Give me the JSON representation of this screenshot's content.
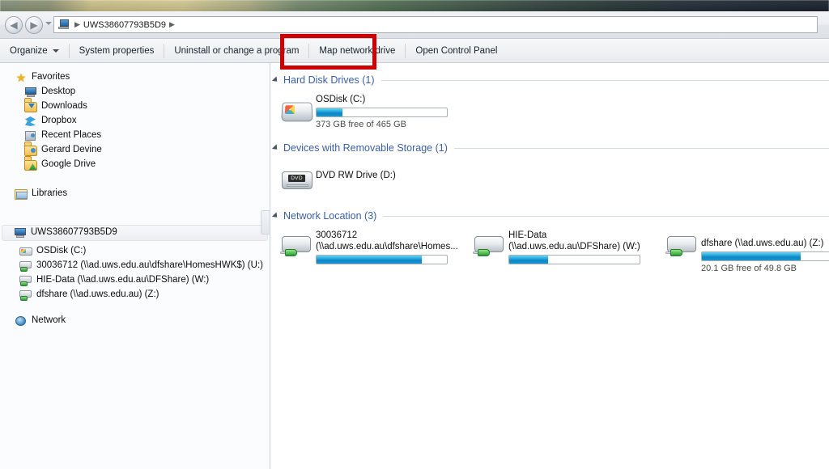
{
  "window": {
    "address_path": "UWS38607793B5D9",
    "address_icon": "computer-icon",
    "back_icon": "back-arrow-icon",
    "forward_icon": "forward-arrow-icon",
    "history_icon": "chevron-down-icon"
  },
  "toolbar": {
    "items": [
      {
        "label": "Organize",
        "has_caret": true
      },
      {
        "label": "System properties",
        "has_caret": false
      },
      {
        "label": "Uninstall or change a program",
        "has_caret": false
      },
      {
        "label": "Map network drive",
        "has_caret": false
      },
      {
        "label": "Open Control Panel",
        "has_caret": false
      }
    ],
    "highlighted_item": "Map network drive",
    "highlight_color": "#cc0000"
  },
  "sidebar": {
    "groups": [
      {
        "name": "Favorites",
        "icon": "star-icon",
        "items": [
          {
            "label": "Desktop",
            "icon": "monitor-icon"
          },
          {
            "label": "Downloads",
            "icon": "downloads-folder-icon"
          },
          {
            "label": "Dropbox",
            "icon": "dropbox-icon"
          },
          {
            "label": "Recent Places",
            "icon": "recent-places-icon"
          },
          {
            "label": "Gerard Devine",
            "icon": "user-folder-icon"
          },
          {
            "label": "Google Drive",
            "icon": "google-drive-icon"
          }
        ]
      },
      {
        "name": "Libraries",
        "icon": "libraries-icon",
        "items": []
      },
      {
        "name": "UWS38607793B5D9",
        "icon": "computer-icon",
        "selected": true,
        "items": [
          {
            "label": "OSDisk (C:)",
            "icon": "hard-disk-icon"
          },
          {
            "label": "30036712 (\\\\ad.uws.edu.au\\dfshare\\HomesHWK$) (U:)",
            "icon": "network-drive-icon"
          },
          {
            "label": "HIE-Data (\\\\ad.uws.edu.au\\DFShare) (W:)",
            "icon": "network-drive-icon"
          },
          {
            "label": "dfshare (\\\\ad.uws.edu.au) (Z:)",
            "icon": "network-drive-icon"
          }
        ]
      },
      {
        "name": "Network",
        "icon": "network-globe-icon",
        "items": []
      }
    ]
  },
  "content": {
    "sections": [
      {
        "title": "Hard Disk Drives (1)",
        "drives": [
          {
            "name": "OSDisk (C:)",
            "subtitle": "",
            "icon": "hard-disk-icon",
            "has_meter": true,
            "used_percent": 20,
            "free_text": "373 GB free of 465 GB"
          }
        ]
      },
      {
        "title": "Devices with Removable Storage (1)",
        "drives": [
          {
            "name": "DVD RW Drive (D:)",
            "subtitle": "",
            "icon": "dvd-drive-icon",
            "dvd_label": "DVD",
            "has_meter": false,
            "used_percent": 0,
            "free_text": ""
          }
        ]
      },
      {
        "title": "Network Location (3)",
        "drives": [
          {
            "name": "30036712",
            "subtitle": "(\\\\ad.uws.edu.au\\dfshare\\Homes...",
            "icon": "network-drive-icon",
            "has_meter": true,
            "used_percent": 81,
            "free_text": ""
          },
          {
            "name": "HIE-Data",
            "subtitle": "(\\\\ad.uws.edu.au\\DFShare) (W:)",
            "icon": "network-drive-icon",
            "has_meter": true,
            "used_percent": 30,
            "free_text": ""
          },
          {
            "name": "dfshare (\\\\ad.uws.edu.au) (Z:)",
            "subtitle": "",
            "icon": "network-drive-icon",
            "has_meter": true,
            "used_percent": 76,
            "free_text": "20.1 GB free of 49.8 GB"
          }
        ]
      }
    ]
  }
}
